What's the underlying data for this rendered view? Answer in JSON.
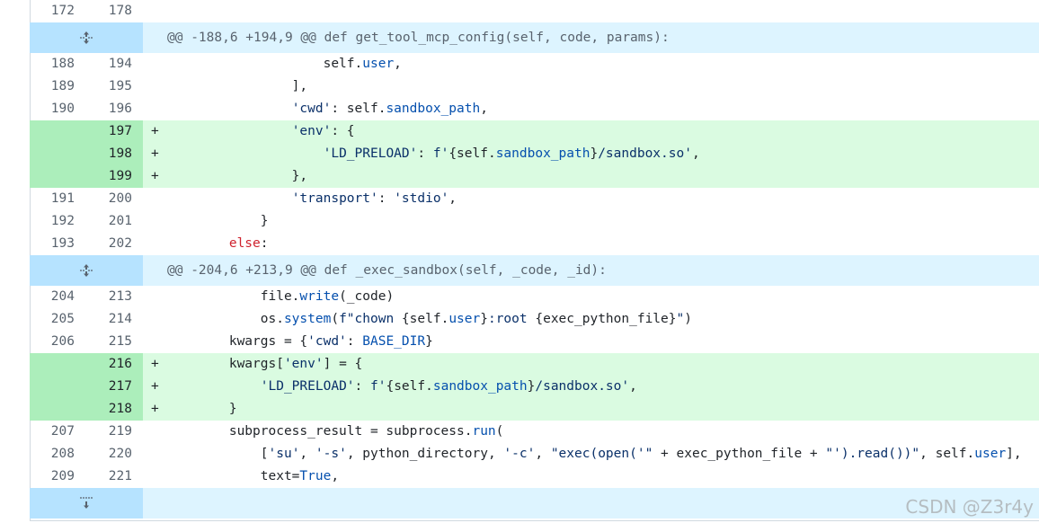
{
  "rows": [
    {
      "type": "ctx",
      "old": "172",
      "new": "178",
      "sign": "",
      "tokens": []
    },
    {
      "type": "hunk",
      "expand": "both",
      "header": "@@ -188,6 +194,9 @@ def get_tool_mcp_config(self, code, params):"
    },
    {
      "type": "ctx",
      "old": "188",
      "new": "194",
      "sign": "",
      "tokens": [
        [
          "p",
          "                    self."
        ],
        [
          "f",
          "user"
        ],
        [
          "p",
          ","
        ]
      ]
    },
    {
      "type": "ctx",
      "old": "189",
      "new": "195",
      "sign": "",
      "tokens": [
        [
          "p",
          "                ],"
        ]
      ]
    },
    {
      "type": "ctx",
      "old": "190",
      "new": "196",
      "sign": "",
      "tokens": [
        [
          "p",
          "                "
        ],
        [
          "s",
          "'cwd'"
        ],
        [
          "p",
          ": self."
        ],
        [
          "f",
          "sandbox_path"
        ],
        [
          "p",
          ","
        ]
      ]
    },
    {
      "type": "add",
      "old": "",
      "new": "197",
      "sign": "+",
      "tokens": [
        [
          "p",
          "                "
        ],
        [
          "s",
          "'env'"
        ],
        [
          "p",
          ": {"
        ]
      ]
    },
    {
      "type": "add",
      "old": "",
      "new": "198",
      "sign": "+",
      "tokens": [
        [
          "p",
          "                    "
        ],
        [
          "s",
          "'LD_PRELOAD'"
        ],
        [
          "p",
          ": "
        ],
        [
          "s",
          "f'"
        ],
        [
          "p",
          "{self."
        ],
        [
          "f",
          "sandbox_path"
        ],
        [
          "p",
          "}"
        ],
        [
          "s",
          "/sandbox.so'"
        ],
        [
          "p",
          ","
        ]
      ]
    },
    {
      "type": "add",
      "old": "",
      "new": "199",
      "sign": "+",
      "tokens": [
        [
          "p",
          "                },"
        ]
      ]
    },
    {
      "type": "ctx",
      "old": "191",
      "new": "200",
      "sign": "",
      "tokens": [
        [
          "p",
          "                "
        ],
        [
          "s",
          "'transport'"
        ],
        [
          "p",
          ": "
        ],
        [
          "s",
          "'stdio'"
        ],
        [
          "p",
          ","
        ]
      ]
    },
    {
      "type": "ctx",
      "old": "192",
      "new": "201",
      "sign": "",
      "tokens": [
        [
          "p",
          "            }"
        ]
      ]
    },
    {
      "type": "ctx",
      "old": "193",
      "new": "202",
      "sign": "",
      "tokens": [
        [
          "p",
          "        "
        ],
        [
          "k",
          "else"
        ],
        [
          "p",
          ":"
        ]
      ]
    },
    {
      "type": "hunk",
      "expand": "both",
      "header": "@@ -204,6 +213,9 @@ def _exec_sandbox(self, _code, _id):"
    },
    {
      "type": "ctx",
      "old": "204",
      "new": "213",
      "sign": "",
      "tokens": [
        [
          "p",
          "            file."
        ],
        [
          "f",
          "write"
        ],
        [
          "p",
          "(_code)"
        ]
      ]
    },
    {
      "type": "ctx",
      "old": "205",
      "new": "214",
      "sign": "",
      "tokens": [
        [
          "p",
          "            os."
        ],
        [
          "f",
          "system"
        ],
        [
          "p",
          "("
        ],
        [
          "s",
          "f\"chown "
        ],
        [
          "p",
          "{self."
        ],
        [
          "f",
          "user"
        ],
        [
          "p",
          "}"
        ],
        [
          "s",
          ":root "
        ],
        [
          "p",
          "{exec_python_file}"
        ],
        [
          "s",
          "\""
        ],
        [
          "p",
          ")"
        ]
      ]
    },
    {
      "type": "ctx",
      "old": "206",
      "new": "215",
      "sign": "",
      "tokens": [
        [
          "p",
          "        kwargs = {"
        ],
        [
          "s",
          "'cwd'"
        ],
        [
          "p",
          ": "
        ],
        [
          "f",
          "BASE_DIR"
        ],
        [
          "p",
          "}"
        ]
      ]
    },
    {
      "type": "add",
      "old": "",
      "new": "216",
      "sign": "+",
      "tokens": [
        [
          "p",
          "        kwargs["
        ],
        [
          "s",
          "'env'"
        ],
        [
          "p",
          "] = {"
        ]
      ]
    },
    {
      "type": "add",
      "old": "",
      "new": "217",
      "sign": "+",
      "tokens": [
        [
          "p",
          "            "
        ],
        [
          "s",
          "'LD_PRELOAD'"
        ],
        [
          "p",
          ": "
        ],
        [
          "s",
          "f'"
        ],
        [
          "p",
          "{self."
        ],
        [
          "f",
          "sandbox_path"
        ],
        [
          "p",
          "}"
        ],
        [
          "s",
          "/sandbox.so'"
        ],
        [
          "p",
          ","
        ]
      ]
    },
    {
      "type": "add",
      "old": "",
      "new": "218",
      "sign": "+",
      "tokens": [
        [
          "p",
          "        }"
        ]
      ]
    },
    {
      "type": "ctx",
      "old": "207",
      "new": "219",
      "sign": "",
      "tokens": [
        [
          "p",
          "        subprocess_result = subprocess."
        ],
        [
          "f",
          "run"
        ],
        [
          "p",
          "("
        ]
      ]
    },
    {
      "type": "ctx",
      "old": "208",
      "new": "220",
      "sign": "",
      "tokens": [
        [
          "p",
          "            ["
        ],
        [
          "s",
          "'su'"
        ],
        [
          "p",
          ", "
        ],
        [
          "s",
          "'-s'"
        ],
        [
          "p",
          ", python_directory, "
        ],
        [
          "s",
          "'-c'"
        ],
        [
          "p",
          ", "
        ],
        [
          "s",
          "\"exec(open('\""
        ],
        [
          "p",
          " + exec_python_file + "
        ],
        [
          "s",
          "\"').read())\""
        ],
        [
          "p",
          ", self."
        ],
        [
          "f",
          "user"
        ],
        [
          "p",
          "],"
        ]
      ]
    },
    {
      "type": "ctx",
      "old": "209",
      "new": "221",
      "sign": "",
      "tokens": [
        [
          "p",
          "            text="
        ],
        [
          "f",
          "True"
        ],
        [
          "p",
          ","
        ]
      ]
    },
    {
      "type": "hunk",
      "expand": "down",
      "header": ""
    }
  ],
  "watermark": "CSDN @Z3r4y"
}
